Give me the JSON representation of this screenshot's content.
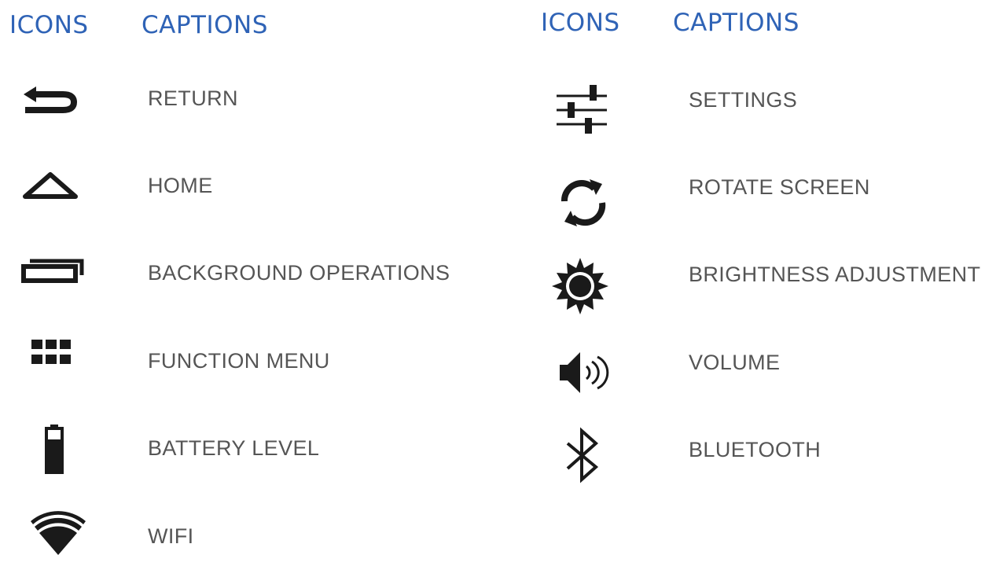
{
  "headers": {
    "left_icons": "ICONS",
    "left_captions": "CAPTIONS",
    "right_icons": "ICONS",
    "right_captions": "CAPTIONS"
  },
  "left_column": [
    {
      "icon": "return-icon",
      "caption": "RETURN"
    },
    {
      "icon": "home-icon",
      "caption": "HOME"
    },
    {
      "icon": "background-operations-icon",
      "caption": "BACKGROUND OPERATIONS"
    },
    {
      "icon": "function-menu-icon",
      "caption": "FUNCTION MENU"
    },
    {
      "icon": "battery-icon",
      "caption": "BATTERY LEVEL"
    },
    {
      "icon": "wifi-icon",
      "caption": "WIFI"
    }
  ],
  "right_column": [
    {
      "icon": "settings-sliders-icon",
      "caption": "SETTINGS"
    },
    {
      "icon": "rotate-screen-icon",
      "caption": "ROTATE SCREEN"
    },
    {
      "icon": "brightness-icon",
      "caption": "BRIGHTNESS ADJUSTMENT"
    },
    {
      "icon": "volume-icon",
      "caption": "VOLUME"
    },
    {
      "icon": "bluetooth-icon",
      "caption": "BLUETOOTH"
    }
  ],
  "colors": {
    "header": "#2f63b6",
    "caption": "#555555",
    "icon": "#1a1a1a"
  }
}
